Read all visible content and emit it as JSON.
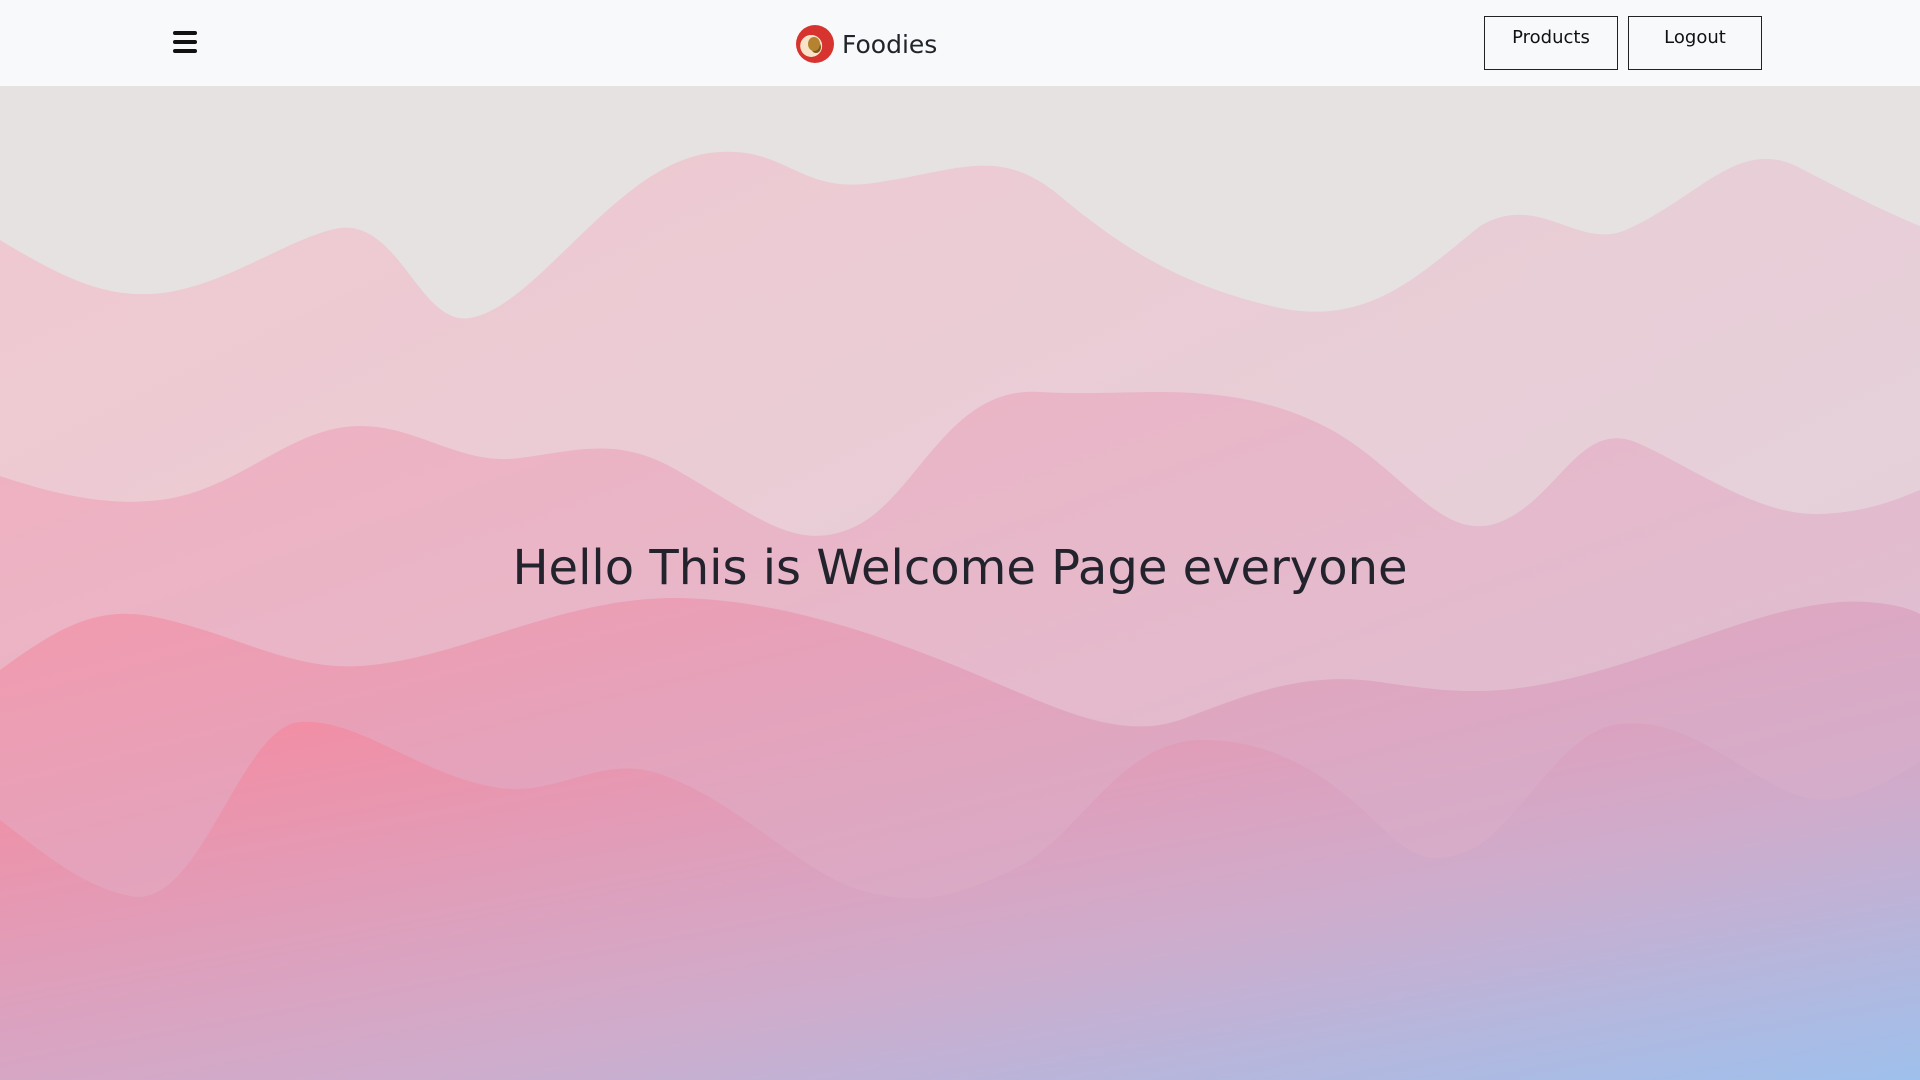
{
  "navbar": {
    "brand_name": "Foodies",
    "menu_icon": "hamburger-menu-icon",
    "logo_icon": "food-bowl-logo",
    "buttons": {
      "products_label": "Products",
      "logout_label": "Logout"
    }
  },
  "main": {
    "heading": "Hello This is Welcome Page everyone"
  },
  "colors": {
    "navbar_bg": "#f8f9fa",
    "page_bg": "#e6e2e2",
    "wave_pink": "#f58aa0",
    "wave_blue": "#9ec0ec",
    "heading_text": "#23232e"
  }
}
